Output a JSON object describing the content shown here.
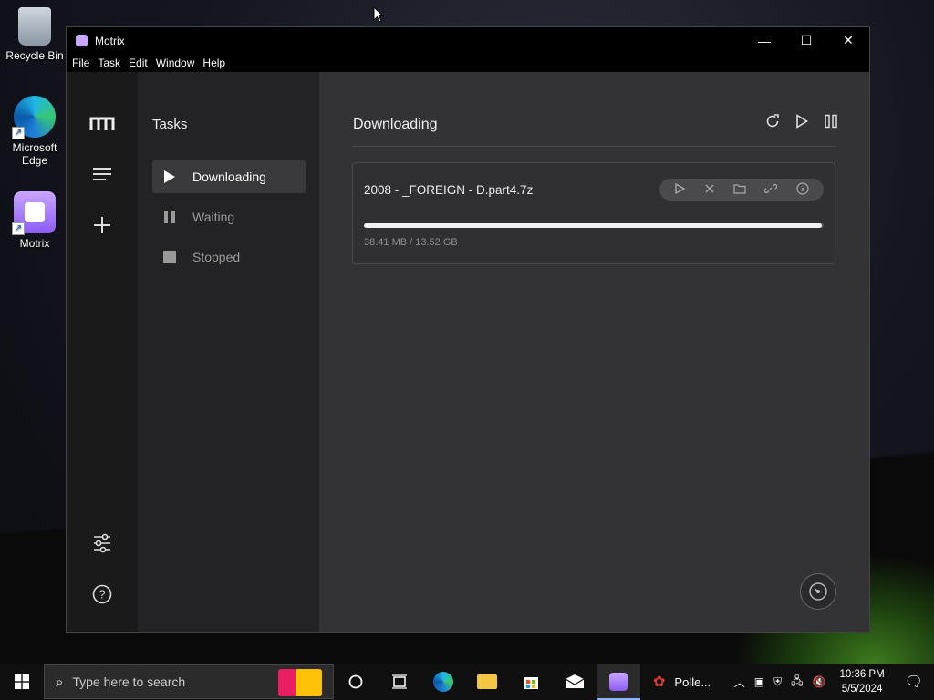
{
  "desktop": {
    "icons": [
      {
        "label": "Recycle Bin"
      },
      {
        "label": "Microsoft Edge"
      },
      {
        "label": "Motrix"
      }
    ]
  },
  "window": {
    "title": "Motrix",
    "controls": {
      "minimize": "—",
      "maximize": "☐",
      "close": "✕"
    }
  },
  "menu": [
    "File",
    "Task",
    "Edit",
    "Window",
    "Help"
  ],
  "sidebar": {
    "logo": "m",
    "icons": [
      "menu-icon",
      "add-icon",
      "settings-sliders-icon",
      "help-icon"
    ]
  },
  "subnav": {
    "heading": "Tasks",
    "items": [
      {
        "label": "Downloading",
        "active": true,
        "icon": "play-icon"
      },
      {
        "label": "Waiting",
        "active": false,
        "icon": "pause-icon"
      },
      {
        "label": "Stopped",
        "active": false,
        "icon": "stop-icon"
      }
    ]
  },
  "main": {
    "heading": "Downloading",
    "tools": [
      "refresh-icon",
      "play-icon",
      "pause-icon"
    ],
    "task": {
      "name": "2008 - _FOREIGN - D.part4.7z",
      "size_text": "38.41 MB / 13.52 GB",
      "progress_fraction": 0.997,
      "actions": [
        "play-icon",
        "close-icon",
        "folder-icon",
        "link-icon",
        "info-icon"
      ]
    }
  },
  "taskbar": {
    "search_placeholder": "Type here to search",
    "pinned_app_label": "Polle...",
    "time": "10:36 PM",
    "date": "5/5/2024"
  }
}
